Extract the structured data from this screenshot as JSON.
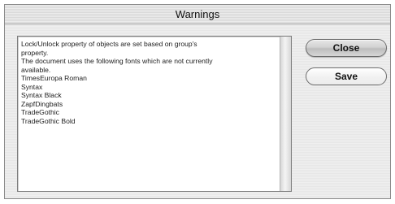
{
  "window": {
    "title": "Warnings"
  },
  "warnings": {
    "lines": [
      "Lock/Unlock property of objects are set based on group's",
      "property.",
      "The document uses the following fonts which are not currently",
      "available.",
      "TimesEuropa Roman",
      "Syntax",
      "Syntax Black",
      "ZapfDingbats",
      "TradeGothic",
      "TradeGothic Bold"
    ]
  },
  "buttons": {
    "close_label": "Close",
    "save_label": "Save"
  },
  "colors": {
    "default_button": "#bdbdbd",
    "panel_background": "#ffffff",
    "dialog_background": "#ebebeb"
  }
}
